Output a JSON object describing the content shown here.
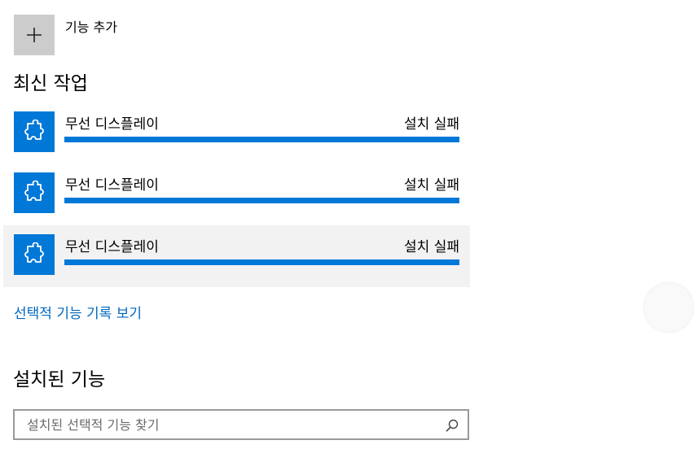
{
  "add_feature": {
    "label": "기능 추가"
  },
  "recent_actions": {
    "heading": "최신 작업",
    "items": [
      {
        "name": "무선 디스플레이",
        "status": "설치 실패",
        "progress": 1.0
      },
      {
        "name": "무선 디스플레이",
        "status": "설치 실패",
        "progress": 1.0
      },
      {
        "name": "무선 디스플레이",
        "status": "설치 실패",
        "progress": 1.0
      }
    ]
  },
  "history_link": "선택적 기능 기록 보기",
  "installed": {
    "heading": "설치된 기능",
    "search_placeholder": "설치된 선택적 기능 찾기"
  },
  "colors": {
    "accent": "#0078d7",
    "link": "#0067c0",
    "add_tile": "#cccccc"
  },
  "icons": {
    "add": "plus-icon",
    "feature": "puzzle-piece-icon",
    "search": "search-icon"
  }
}
